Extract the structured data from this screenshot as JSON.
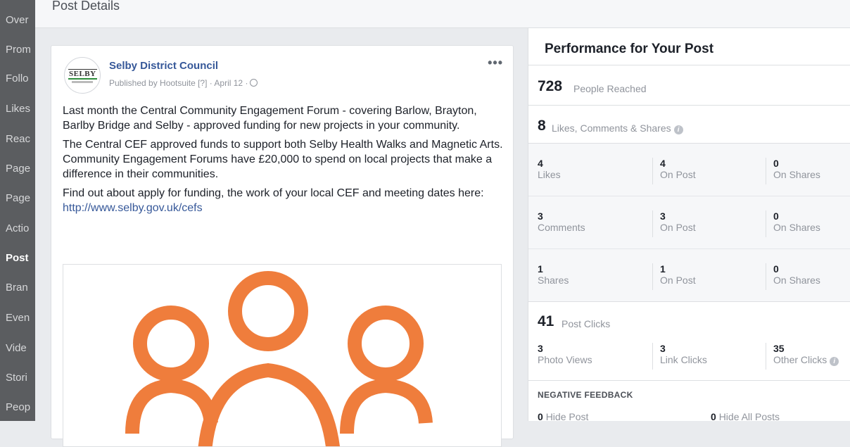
{
  "sidebar": {
    "items": [
      {
        "label": "Over",
        "active": false
      },
      {
        "label": "Prom",
        "active": false
      },
      {
        "label": "Follo",
        "active": false
      },
      {
        "label": "Likes",
        "active": false
      },
      {
        "label": "Reac",
        "active": false
      },
      {
        "label": "Page",
        "active": false
      },
      {
        "label": "Page",
        "active": false
      },
      {
        "label": "Actio",
        "active": false
      },
      {
        "label": "Post",
        "active": true
      },
      {
        "label": "Bran",
        "active": false
      },
      {
        "label": "Even",
        "active": false
      },
      {
        "label": "Vide",
        "active": false
      },
      {
        "label": "Stori",
        "active": false
      },
      {
        "label": "Peop",
        "active": false
      }
    ]
  },
  "header": {
    "title": "Post Details"
  },
  "post": {
    "page_name": "Selby District Council",
    "avatar_text": "SELBY",
    "meta": "Published by Hootsuite [?] · April 12 ·",
    "more": "•••",
    "paragraph1": "Last month the Central Community Engagement Forum - covering Barlow, Brayton, Barlby Bridge and Selby - approved funding for new projects in your community.",
    "paragraph2": "The Central CEF approved funds to support both Selby Health Walks and Magnetic Arts. Community Engagement Forums have £20,000 to spend on local projects that make a difference in their communities.",
    "paragraph3_text": "Find out about apply for funding, the work of your local CEF and meeting dates here: ",
    "paragraph3_link": "http://www.selby.gov.uk/cefs",
    "image_color": "#ef7d3c"
  },
  "performance": {
    "title": "Performance for Your Post",
    "reached": {
      "value": "728",
      "label": "People Reached"
    },
    "engagement": {
      "value": "8",
      "label": "Likes, Comments & Shares"
    },
    "rows": [
      {
        "total": "4",
        "total_label": "Likes",
        "on_post": "4",
        "on_post_label": "On Post",
        "on_shares": "0",
        "on_shares_label": "On Shares"
      },
      {
        "total": "3",
        "total_label": "Comments",
        "on_post": "3",
        "on_post_label": "On Post",
        "on_shares": "0",
        "on_shares_label": "On Shares"
      },
      {
        "total": "1",
        "total_label": "Shares",
        "on_post": "1",
        "on_post_label": "On Post",
        "on_shares": "0",
        "on_shares_label": "On Shares"
      }
    ],
    "clicks": {
      "value": "41",
      "label": "Post Clicks"
    },
    "click_breakdown": [
      {
        "value": "3",
        "label": "Photo Views"
      },
      {
        "value": "3",
        "label": "Link Clicks"
      },
      {
        "value": "35",
        "label": "Other Clicks"
      }
    ],
    "negative_title": "NEGATIVE FEEDBACK",
    "negative": [
      {
        "value": "0",
        "label": "Hide Post"
      },
      {
        "value": "0",
        "label": "Hide All Posts"
      }
    ]
  }
}
